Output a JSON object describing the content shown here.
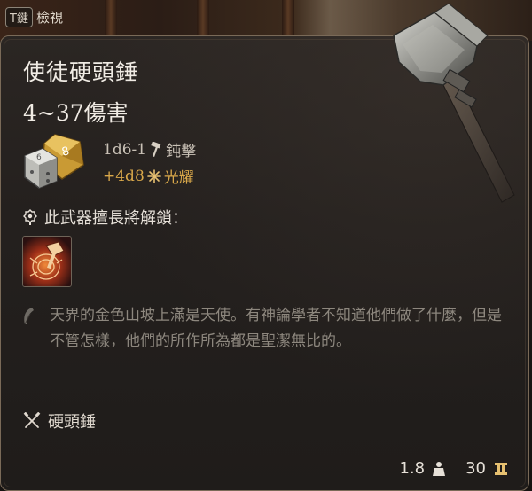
{
  "key_hint": {
    "key": "T鍵",
    "label": "檢視"
  },
  "item": {
    "name": "使徒硬頭錘",
    "damage_range": "4~37傷害",
    "damage_rows": [
      {
        "dice": "1d6-1",
        "type": "鈍擊",
        "icon": "hammer-icon"
      },
      {
        "dice": "+4d8",
        "type": "光耀",
        "icon": "radiant-icon"
      }
    ],
    "unlock_text": "此武器擅長將解鎖：",
    "lore": "天界的金色山坡上滿是天使。有神論學者不知道他們做了什麼，但是不管怎樣，他們的所作所為都是聖潔無比的。",
    "category": "硬頭錘",
    "weight": "1.8",
    "price": "30"
  },
  "colors": {
    "title_text": "#f0ebe4",
    "radiant_gold": "#d9a84a",
    "lore_text": "#8d877e",
    "panel_border": "#7a6a58"
  }
}
